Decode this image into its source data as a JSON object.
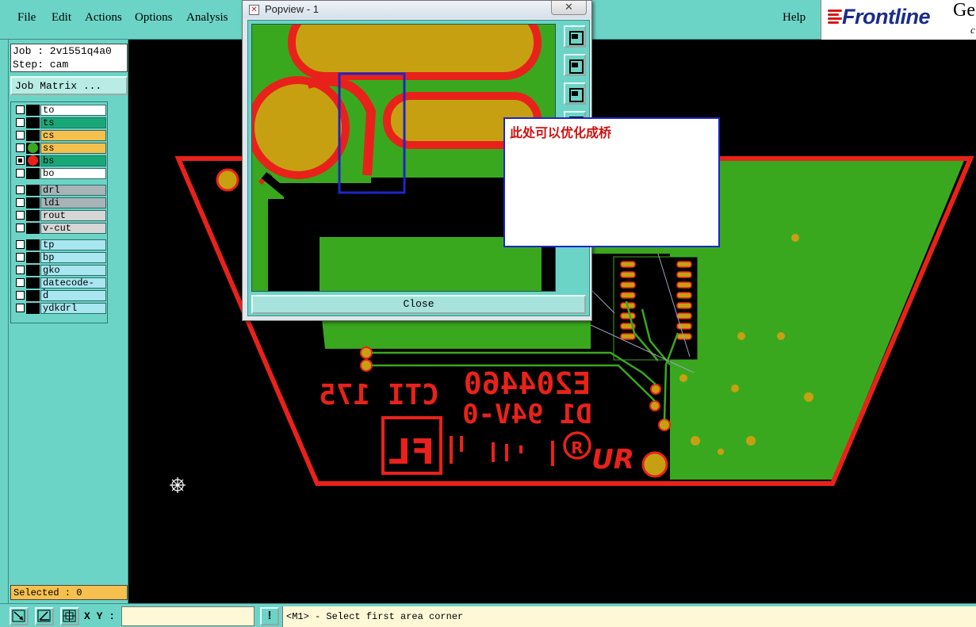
{
  "menu": {
    "file": "File",
    "edit": "Edit",
    "actions": "Actions",
    "options": "Options",
    "analysis": "Analysis",
    "help": "Help"
  },
  "logo": {
    "brand": "Frontline",
    "suffix": "Ge",
    "suffix2": "c"
  },
  "job": {
    "job_line": "Job : 2v1551q4a0",
    "step_line": "Step: cam",
    "matrix_button": "Job Matrix ..."
  },
  "layers": [
    {
      "name": "to",
      "color": "#ffffff",
      "selected": false,
      "dot": ""
    },
    {
      "name": "ts",
      "color": "#18a878",
      "selected": false,
      "dot": ""
    },
    {
      "name": "cs",
      "color": "#f6c04e",
      "selected": false,
      "dot": ""
    },
    {
      "name": "ss",
      "color": "#f6c04e",
      "selected": false,
      "dot": "#3aa81e"
    },
    {
      "name": "bs",
      "color": "#18a878",
      "selected": true,
      "dot": "#e8221a"
    },
    {
      "name": "bo",
      "color": "#ffffff",
      "selected": false,
      "dot": ""
    },
    {
      "name": "drl",
      "color": "#a7b3b7",
      "selected": false,
      "dot": ""
    },
    {
      "name": "ldi",
      "color": "#a7b3b7",
      "selected": false,
      "dot": ""
    },
    {
      "name": "rout",
      "color": "#d6d6d6",
      "selected": false,
      "dot": ""
    },
    {
      "name": "v-cut",
      "color": "#d6d6d6",
      "selected": false,
      "dot": ""
    },
    {
      "name": "tp",
      "color": "#a8e6f0",
      "selected": false,
      "dot": ""
    },
    {
      "name": "bp",
      "color": "#a8e6f0",
      "selected": false,
      "dot": ""
    },
    {
      "name": "gko",
      "color": "#a8e6f0",
      "selected": false,
      "dot": ""
    },
    {
      "name": "datecode-bs",
      "color": "#a8e6f0",
      "selected": false,
      "dot": ""
    },
    {
      "name": "d",
      "color": "#a8e6f0",
      "selected": false,
      "dot": ""
    },
    {
      "name": "ydkdrl",
      "color": "#a8e6f0",
      "selected": false,
      "dot": ""
    }
  ],
  "selected_status": "Selected : 0",
  "popup": {
    "title": "Popview - 1",
    "close_x": "✕",
    "close_button": "Close"
  },
  "annotation": {
    "text": "此处可以优化成桥"
  },
  "board_text": {
    "line1": "E204460",
    "line2": "CTI 175",
    "line3": "D1  94V-0",
    "logo_fl": "FL",
    "logo_ur": "UR"
  },
  "status": {
    "xy_label": "X Y :",
    "xy_value": "",
    "exclaim": "!",
    "message": "<M1> - Select first area corner"
  },
  "colors": {
    "panel": "#6cd4c6",
    "copper": "#3aa81e",
    "pad": "#c7a012",
    "outline": "#e8221a",
    "annotation_border": "#1c27c6"
  }
}
